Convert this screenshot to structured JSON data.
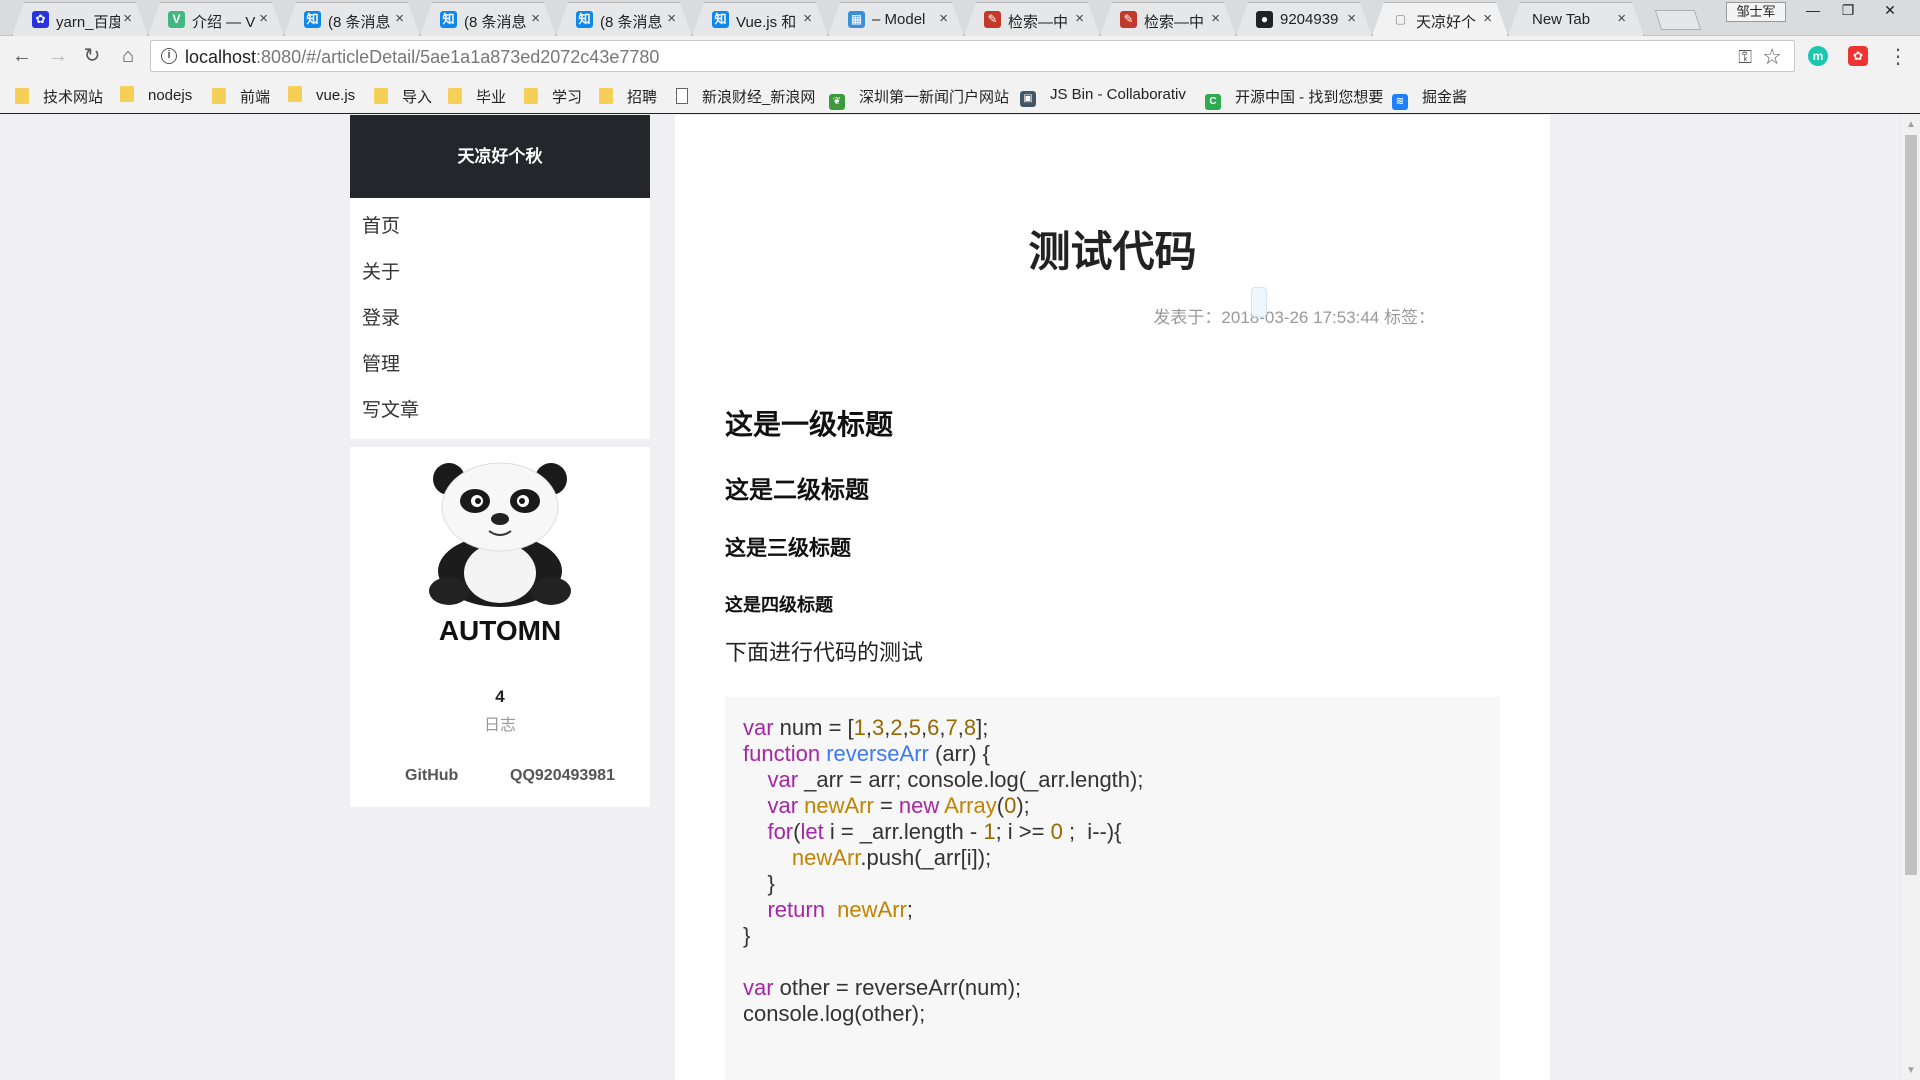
{
  "browser": {
    "tabs": [
      {
        "title": "yarn_百度",
        "icon": "baidu",
        "color": "#2932e1"
      },
      {
        "title": "介绍 — V",
        "icon": "vue",
        "color": "#41b883"
      },
      {
        "title": "(8 条消息",
        "icon": "zhihu",
        "color": "#0f88eb"
      },
      {
        "title": "(8 条消息",
        "icon": "zhihu",
        "color": "#0f88eb"
      },
      {
        "title": "(8 条消息",
        "icon": "zhihu",
        "color": "#0f88eb"
      },
      {
        "title": "Vue.js 和",
        "icon": "zhihu",
        "color": "#0f88eb"
      },
      {
        "title": "– Model",
        "icon": "chart",
        "color": "#3b8fd6"
      },
      {
        "title": "检索—中",
        "icon": "sogou",
        "color": "#c0392b"
      },
      {
        "title": "检索—中",
        "icon": "sogou",
        "color": "#c0392b"
      },
      {
        "title": "9204939",
        "icon": "github",
        "color": "#222222"
      },
      {
        "title": "天凉好个",
        "icon": "page",
        "color": "#888888"
      },
      {
        "title": "New Tab",
        "icon": "",
        "color": "#888888"
      }
    ],
    "profile_label": "邹士军",
    "url_host": "localhost",
    "url_path": ":8080/#/articleDetail/5ae1a1a873ed2072c43e7780",
    "bookmarks": [
      {
        "label": "技术网站",
        "type": "folder"
      },
      {
        "label": "nodejs",
        "type": "folder"
      },
      {
        "label": "前端",
        "type": "folder"
      },
      {
        "label": "vue.js",
        "type": "folder"
      },
      {
        "label": "导入",
        "type": "folder"
      },
      {
        "label": "毕业",
        "type": "folder"
      },
      {
        "label": "学习",
        "type": "folder"
      },
      {
        "label": "招聘",
        "type": "folder"
      },
      {
        "label": "新浪财经_新浪网",
        "type": "page"
      },
      {
        "label": "深圳第一新闻门户网站",
        "type": "leaf-icon"
      },
      {
        "label": "JS Bin - Collaborativ",
        "type": "jsbin-icon"
      },
      {
        "label": "开源中国 - 找到您想要",
        "type": "oschina-icon"
      },
      {
        "label": "掘金酱",
        "type": "juejin-icon"
      }
    ]
  },
  "site": {
    "brand": "天凉好个秋",
    "menu": [
      "首页",
      "关于",
      "登录",
      "管理",
      "写文章"
    ],
    "profile": {
      "name": "AUTOMN",
      "post_count": "4",
      "post_label": "日志",
      "github_label": "GitHub",
      "qq_label": "QQ920493981"
    }
  },
  "article": {
    "title": "测试代码",
    "meta": "发表于：2018-03-26 17:53:44 标签：",
    "h1": "这是一级标题",
    "h2": "这是二级标题",
    "h3": "这是三级标题",
    "h4": "这是四级标题",
    "paragraph": "下面进行代码的测试",
    "code": [
      "var num = [1,3,2,5,6,7,8];",
      "function reverseArr (arr) {",
      "    var _arr = arr; console.log(_arr.length);",
      "    var newArr = new Array(0);",
      "    for(let i = _arr.length - 1; i >= 0 ;  i--){",
      "        newArr.push(_arr[i]);",
      "    }",
      "    return  newArr;",
      "}",
      "",
      "var other = reverseArr(num);",
      "console.log(other);"
    ]
  }
}
